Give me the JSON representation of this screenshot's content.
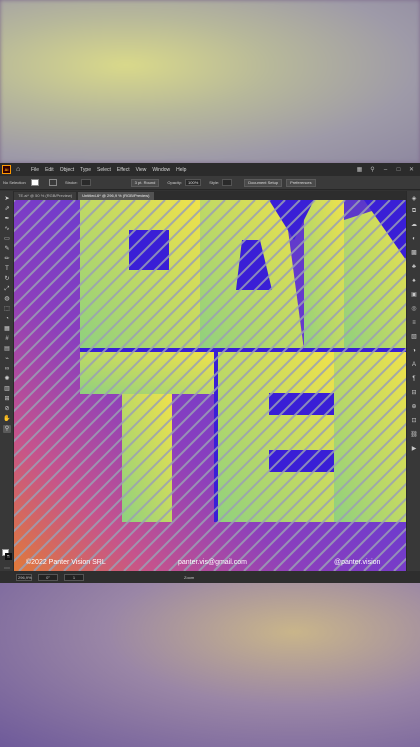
{
  "menubar": {
    "logo": "Ai",
    "items": [
      "File",
      "Edit",
      "Object",
      "Type",
      "Select",
      "Effect",
      "View",
      "Window",
      "Help"
    ],
    "icons": [
      "home-icon",
      "arrange-icon",
      "search-icon",
      "minimize-icon",
      "maximize-icon",
      "close-icon"
    ]
  },
  "controlbar": {
    "selection": "No Selection",
    "stroke_label": "Stroke:",
    "stroke_profile": "3 pt. Round",
    "opacity_label": "Opacity:",
    "opacity_value": "100%",
    "style_label": "Style:",
    "doc_setup": "Document Setup",
    "preferences": "Preferences"
  },
  "tabs": [
    {
      "label": "TE.ai* @ 50 % (RGB/Preview)",
      "active": false
    },
    {
      "label": "Untitled-6* @ 296,9 % (RGB/Preview)",
      "active": true
    }
  ],
  "canvas": {
    "letters_top": "PAN",
    "letters_bottom": "TE",
    "fill_gradient_from": "#8fd07f",
    "fill_gradient_to": "#f0e24a",
    "shadow_color": "#3a1fd6",
    "stripe_color": "#9aa0b4"
  },
  "footer": {
    "copyright": "©2022 Panter Vision SRL",
    "email": "panter.vis@gmail.com",
    "handle": "@panter.vision"
  },
  "statusbar": {
    "zoom": "296,9%",
    "rotation": "0°",
    "artboard": "1",
    "mode": "Zoom"
  }
}
